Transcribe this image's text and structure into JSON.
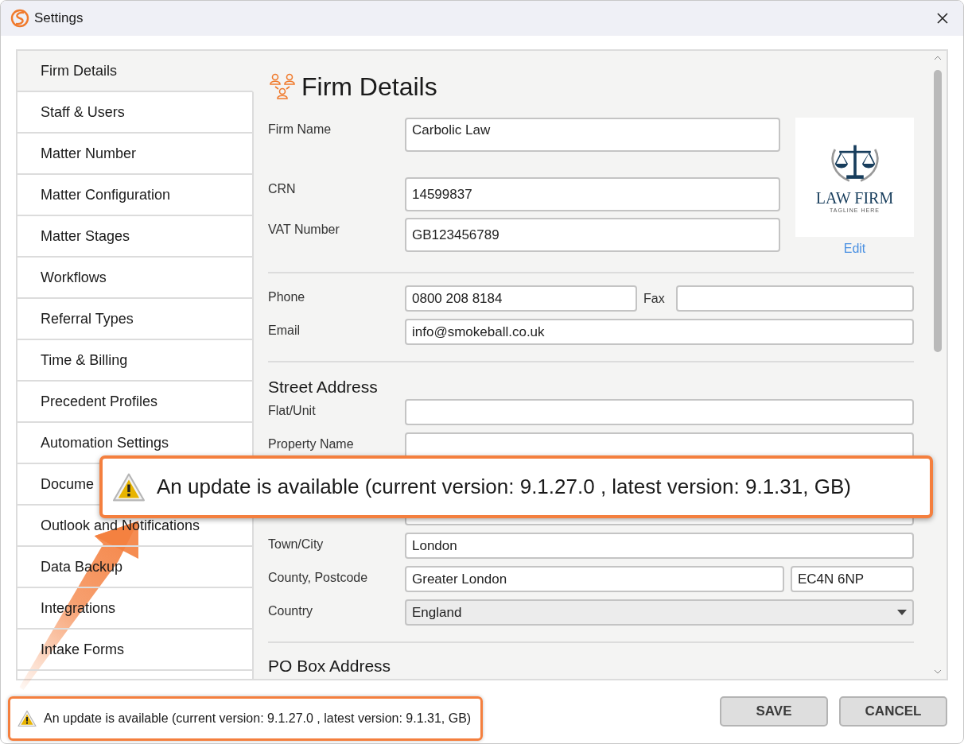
{
  "window": {
    "title": "Settings"
  },
  "sidebar": {
    "items": [
      {
        "label": "Firm Details",
        "selected": true
      },
      {
        "label": "Staff & Users",
        "selected": false
      },
      {
        "label": "Matter Number",
        "selected": false
      },
      {
        "label": "Matter Configuration",
        "selected": false
      },
      {
        "label": "Matter Stages",
        "selected": false
      },
      {
        "label": "Workflows",
        "selected": false
      },
      {
        "label": "Referral Types",
        "selected": false
      },
      {
        "label": "Time & Billing",
        "selected": false
      },
      {
        "label": "Precedent Profiles",
        "selected": false
      },
      {
        "label": "Automation Settings",
        "selected": false
      },
      {
        "label": "Docume",
        "selected": false
      },
      {
        "label": "Outlook and Notifications",
        "selected": false
      },
      {
        "label": "Data Backup",
        "selected": false
      },
      {
        "label": "Integrations",
        "selected": false
      },
      {
        "label": "Intake Forms",
        "selected": false
      }
    ]
  },
  "page": {
    "title": "Firm Details",
    "logo": {
      "name": "LAW FIRM",
      "tagline": "TAGLINE HERE",
      "action": "Edit"
    },
    "sections": [
      {
        "rows": [
          {
            "label": "Firm Name",
            "inputs": [
              {
                "value": "Carbolic Law"
              }
            ]
          },
          {
            "label": "CRN",
            "inputs": [
              {
                "value": "14599837"
              }
            ]
          },
          {
            "label": "VAT Number",
            "inputs": [
              {
                "value": "GB123456789"
              }
            ]
          }
        ]
      },
      {
        "rows": [
          {
            "label": "Phone",
            "inputs": [
              {
                "value": "0800 208 8184"
              },
              {
                "label": "Fax"
              }
            ]
          },
          {
            "label": "Email",
            "inputs": [
              {
                "value": "info@smokeball.co.uk"
              }
            ]
          }
        ]
      },
      {
        "heading": "Street Address",
        "rows": [
          {
            "label": "Flat/Unit",
            "inputs": [
              {
                "kind": "text"
              }
            ]
          },
          {
            "label": "Property Name",
            "inputs": [
              {
                "kind": "text"
              }
            ]
          },
          {
            "inputs": [
              {
                "kind": "text"
              }
            ]
          },
          {
            "label": "Town/City",
            "inputs": [
              {
                "value": "London"
              }
            ]
          },
          {
            "label": "County, Postcode",
            "inputs": [
              {
                "value": "Greater London"
              },
              {
                "value": "EC4N 6NP"
              }
            ]
          },
          {
            "label": "Country",
            "inputs": [
              {
                "value": "England",
                "kind": "select"
              }
            ]
          }
        ]
      },
      {
        "heading": "PO Box Address"
      }
    ]
  },
  "status_bar": {
    "notice": "An update is available (current version: 9.1.27.0 , latest version: 9.1.31, GB)"
  },
  "buttons": [
    "SAVE",
    "CANCEL"
  ],
  "callout": {
    "text": "An update is available (current version: 9.1.27.0 , latest version: 9.1.31, GB)"
  }
}
